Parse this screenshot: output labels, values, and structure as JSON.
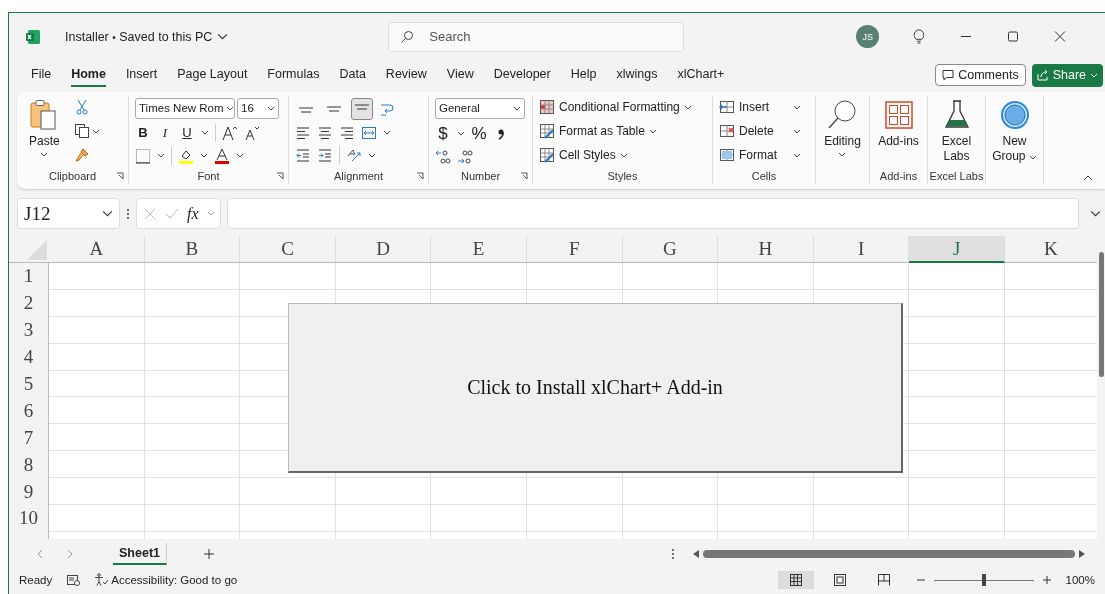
{
  "window": {
    "file_name": "Installer",
    "title_separator": "•",
    "save_status": "Saved to this PC",
    "search_placeholder": "Search",
    "account_initials": "JS"
  },
  "ribbon_tabs": [
    {
      "label": "File",
      "selected": false
    },
    {
      "label": "Home",
      "selected": true
    },
    {
      "label": "Insert",
      "selected": false
    },
    {
      "label": "Page Layout",
      "selected": false
    },
    {
      "label": "Formulas",
      "selected": false
    },
    {
      "label": "Data",
      "selected": false
    },
    {
      "label": "Review",
      "selected": false
    },
    {
      "label": "View",
      "selected": false
    },
    {
      "label": "Developer",
      "selected": false
    },
    {
      "label": "Help",
      "selected": false
    },
    {
      "label": "xlwings",
      "selected": false
    },
    {
      "label": "xlChart+",
      "selected": false
    }
  ],
  "header_buttons": {
    "comments": "Comments",
    "share": "Share"
  },
  "ribbon": {
    "clipboard": {
      "label": "Clipboard",
      "paste": "Paste"
    },
    "font": {
      "label": "Font",
      "font_name": "Times New Rom",
      "font_size": "16",
      "bold": "B",
      "italic": "I",
      "underline": "U"
    },
    "alignment": {
      "label": "Alignment",
      "vertical_align": [
        {
          "selected": false
        },
        {
          "selected": false
        },
        {
          "selected": true
        }
      ]
    },
    "number": {
      "label": "Number",
      "format": "General",
      "currency": "$",
      "percent": "%"
    },
    "styles": {
      "label": "Styles",
      "items": [
        "Conditional Formatting",
        "Format as Table",
        "Cell Styles"
      ]
    },
    "cells": {
      "label": "Cells",
      "items": [
        "Insert",
        "Delete",
        "Format"
      ]
    },
    "editing": {
      "button": "Editing"
    },
    "add_ins": {
      "label": "Add-ins",
      "button": "Add-ins"
    },
    "excel_labs": {
      "label": "Excel Labs",
      "button": "Excel Labs"
    },
    "new_group": {
      "button": "New Group"
    }
  },
  "formula_bar": {
    "name_box": "J12",
    "function_label": "fx"
  },
  "grid": {
    "columns": [
      {
        "label": "A",
        "selected": false
      },
      {
        "label": "B",
        "selected": false
      },
      {
        "label": "C",
        "selected": false
      },
      {
        "label": "D",
        "selected": false
      },
      {
        "label": "E",
        "selected": false
      },
      {
        "label": "F",
        "selected": false
      },
      {
        "label": "G",
        "selected": false
      },
      {
        "label": "H",
        "selected": false
      },
      {
        "label": "I",
        "selected": false
      },
      {
        "label": "J",
        "selected": true
      },
      {
        "label": "K",
        "selected": false
      }
    ],
    "rows": [
      "1",
      "2",
      "3",
      "4",
      "5",
      "6",
      "7",
      "8",
      "9",
      "10"
    ]
  },
  "overlay_button": "Click to Install xlChart+ Add-in",
  "sheet_tabs": [
    {
      "label": "Sheet1",
      "selected": true
    }
  ],
  "status_bar": {
    "mode": "Ready",
    "accessibility": "Accessibility: Good to go",
    "zoom": {
      "level": 0.5,
      "reading": "100%"
    }
  }
}
